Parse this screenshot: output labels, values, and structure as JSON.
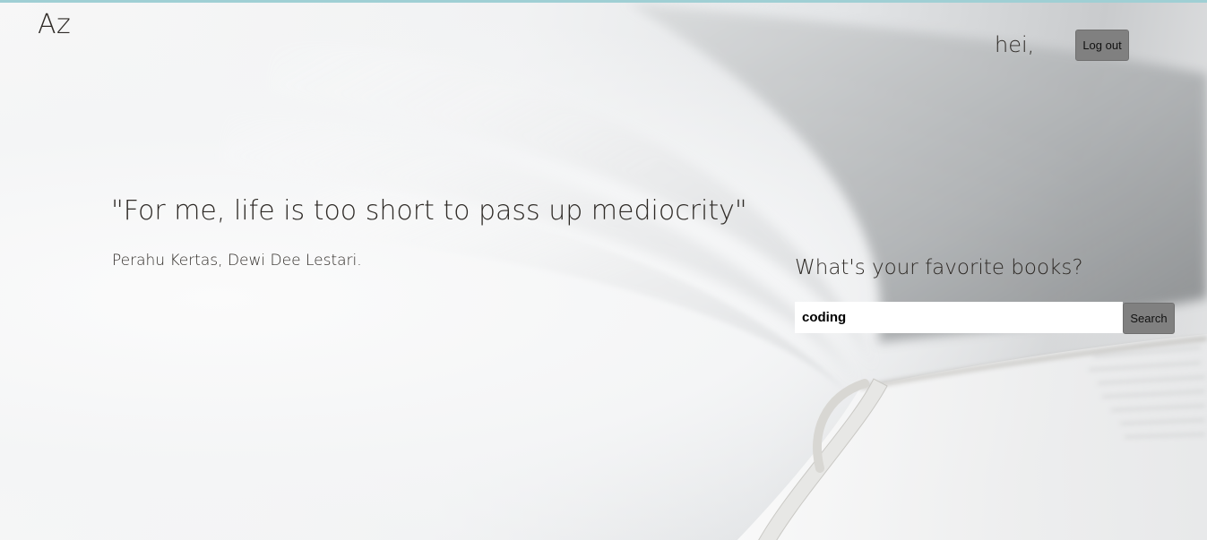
{
  "header": {
    "logo": "Az",
    "greeting": "hei,",
    "logout_label": "Log out"
  },
  "hero": {
    "quote": "\"For me, life is too short to pass up mediocrity\"",
    "attribution": "Perahu Kertas, Dewi Dee Lestari."
  },
  "search": {
    "heading": "What's your favorite books?",
    "value": "coding",
    "button_label": "Search"
  },
  "colors": {
    "button_bg": "#808080",
    "text": "#2e2a26",
    "top_strip": "#9fcfd4"
  }
}
